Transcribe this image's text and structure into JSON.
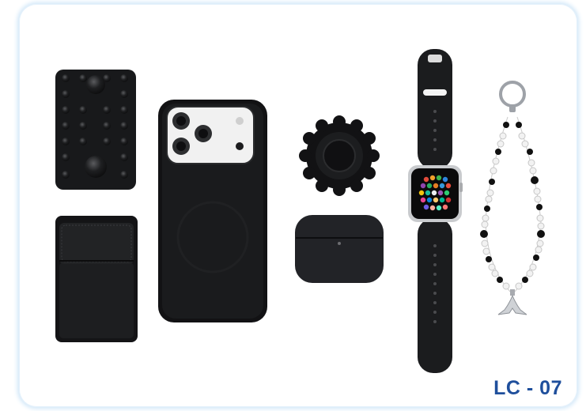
{
  "product": {
    "code_label": "LC - 07",
    "items": [
      {
        "icon": "suction-pad-icon"
      },
      {
        "icon": "leather-card-wallet-icon"
      },
      {
        "icon": "phone-case-icon"
      },
      {
        "icon": "phone-grip-icon"
      },
      {
        "icon": "earbuds-case-icon"
      },
      {
        "icon": "smartwatch-icon"
      },
      {
        "icon": "beaded-charm-strap-icon"
      }
    ]
  },
  "colors": {
    "accent": "#1f4f9c",
    "frame_glow": "#cfe6f8",
    "product_black": "#1b1c1e"
  }
}
